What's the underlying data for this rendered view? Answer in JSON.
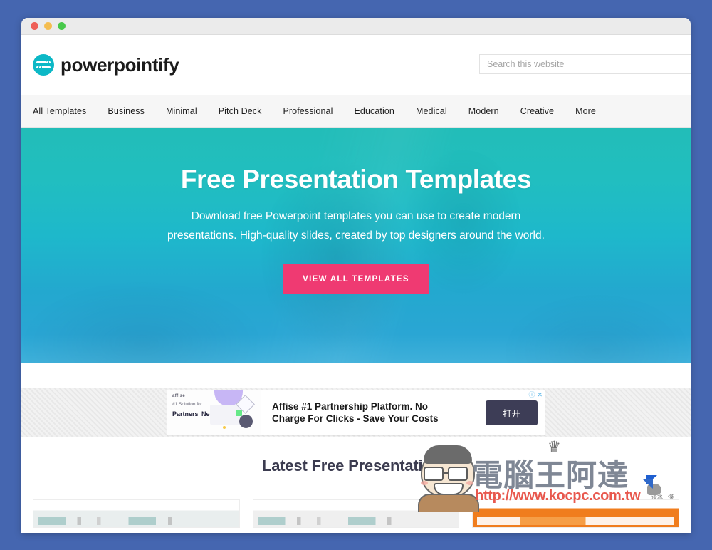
{
  "window": {
    "traffic_lights": [
      "close",
      "minimize",
      "maximize"
    ]
  },
  "site": {
    "logo_text": "powerpointify",
    "logo_icon": "slider-circle-icon"
  },
  "search": {
    "placeholder": "Search this website",
    "value": ""
  },
  "nav": {
    "items": [
      {
        "label": "All Templates"
      },
      {
        "label": "Business"
      },
      {
        "label": "Minimal"
      },
      {
        "label": "Pitch Deck"
      },
      {
        "label": "Professional"
      },
      {
        "label": "Education"
      },
      {
        "label": "Medical"
      },
      {
        "label": "Modern"
      },
      {
        "label": "Creative"
      },
      {
        "label": "More"
      }
    ]
  },
  "hero": {
    "title": "Free Presentation Templates",
    "subtitle": "Download free Powerpoint templates you can use to create modern presentations. High-quality slides, created by top designers around the world.",
    "cta_label": "VIEW ALL TEMPLATES",
    "cta_color": "#ef3a72",
    "gradient_top": "#22bdb8",
    "gradient_bottom": "#3fb0da"
  },
  "ad": {
    "brand": "affise",
    "tagline_small": "#1 Solution for",
    "tagline_line1": "Partners",
    "tagline_line2": "Networks",
    "headline": "Affise #1 Partnership Platform. No Charge For Clicks - Save Your Costs",
    "cta_label": "打开",
    "info_icon": "ⓘ",
    "close_icon": "✕"
  },
  "latest": {
    "title": "Latest Free Presentations"
  },
  "watermark": {
    "site_name": "電腦王阿達",
    "url": "http://www.kocpc.com.tw",
    "suffix": "淡水 · 傑",
    "crown_icon": "♛",
    "face_icon": "cartoon-face-icon"
  }
}
